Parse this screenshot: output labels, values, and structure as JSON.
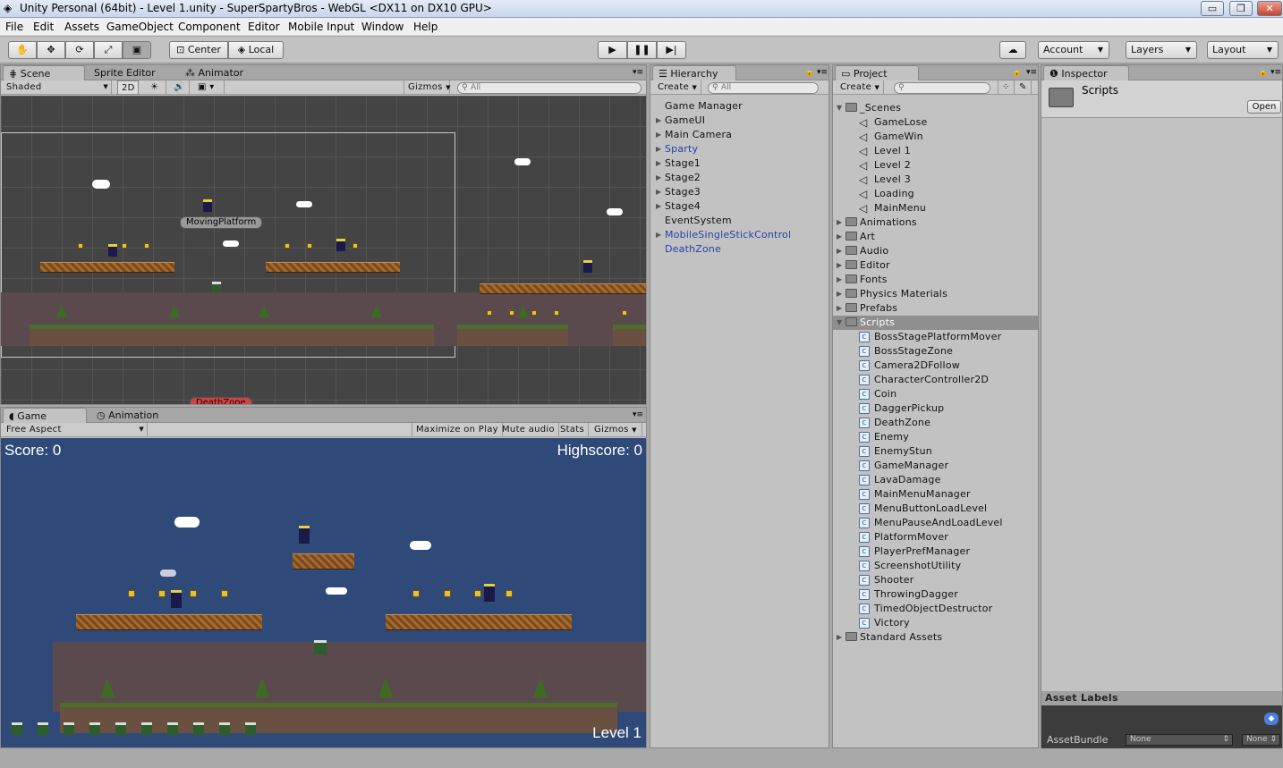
{
  "window": {
    "title": "Unity Personal (64bit) - Level 1.unity - SuperSpartyBros - WebGL <DX11 on DX10 GPU>",
    "min": "▭",
    "max": "❐",
    "close": "✕"
  },
  "menu": [
    "File",
    "Edit",
    "Assets",
    "GameObject",
    "Component",
    "Editor",
    "Mobile Input",
    "Window",
    "Help"
  ],
  "toolbar": {
    "pivot": "Center",
    "space": "Local",
    "account": "Account",
    "layers": "Layers",
    "layout": "Layout"
  },
  "scene": {
    "tabs": [
      "Scene",
      "Sprite Editor",
      "Animator"
    ],
    "shading": "Shaded",
    "mode2d": "2D",
    "gizmos": "Gizmos",
    "search": "All",
    "labels": {
      "moving": "MovingPlatform",
      "death": "DeathZone"
    }
  },
  "game": {
    "tabs": [
      "Game",
      "Animation"
    ],
    "aspect": "Free Aspect",
    "buttons": [
      "Maximize on Play",
      "Mute audio",
      "Stats",
      "Gizmos"
    ],
    "score": "Score: 0",
    "highscore": "Highscore: 0",
    "level": "Level 1"
  },
  "hierarchy": {
    "tab": "Hierarchy",
    "create": "Create",
    "search": "All",
    "items": [
      {
        "label": "Game Manager",
        "arrow": false,
        "blue": false
      },
      {
        "label": "GameUI",
        "arrow": true,
        "blue": false
      },
      {
        "label": "Main Camera",
        "arrow": true,
        "blue": false
      },
      {
        "label": "Sparty",
        "arrow": true,
        "blue": true
      },
      {
        "label": "Stage1",
        "arrow": true,
        "blue": false
      },
      {
        "label": "Stage2",
        "arrow": true,
        "blue": false
      },
      {
        "label": "Stage3",
        "arrow": true,
        "blue": false
      },
      {
        "label": "Stage4",
        "arrow": true,
        "blue": false
      },
      {
        "label": "EventSystem",
        "arrow": false,
        "blue": false
      },
      {
        "label": "MobileSingleStickControl",
        "arrow": true,
        "blue": true
      },
      {
        "label": "DeathZone",
        "arrow": false,
        "blue": true
      }
    ]
  },
  "project": {
    "tab": "Project",
    "create": "Create",
    "scenes_folder": "_Scenes",
    "scenes": [
      "GameLose",
      "GameWin",
      "Level 1",
      "Level 2",
      "Level 3",
      "Loading",
      "MainMenu"
    ],
    "folders": [
      "Animations",
      "Art",
      "Audio",
      "Editor",
      "Fonts",
      "Physics Materials",
      "Prefabs"
    ],
    "scripts_folder": "Scripts",
    "scripts": [
      "BossStagePlatformMover",
      "BossStageZone",
      "Camera2DFollow",
      "CharacterController2D",
      "Coin",
      "DaggerPickup",
      "DeathZone",
      "Enemy",
      "EnemyStun",
      "GameManager",
      "LavaDamage",
      "MainMenuManager",
      "MenuButtonLoadLevel",
      "MenuPauseAndLoadLevel",
      "PlatformMover",
      "PlayerPrefManager",
      "ScreenshotUtility",
      "Shooter",
      "ThrowingDagger",
      "TimedObjectDestructor",
      "Victory"
    ],
    "last_folder": "Standard Assets"
  },
  "inspector": {
    "tab": "Inspector",
    "asset": "Scripts",
    "open": "Open",
    "asset_labels": "Asset Labels",
    "assetbundle": "AssetBundle",
    "none1": "None",
    "none2": "None"
  }
}
